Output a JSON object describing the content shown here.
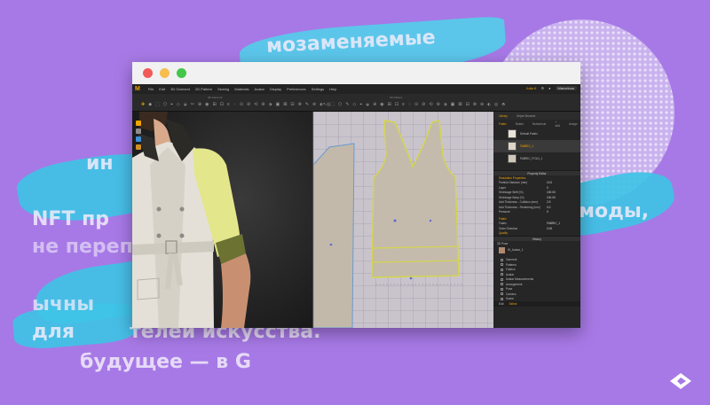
{
  "background": {
    "lines": [
      "мозаменяемые",
      "ин",
      "NFT пр",
      "моды,",
      "не переп",
      "ычны",
      "для",
      "телей искусства.",
      "будущее — в G"
    ],
    "accent": "#3fc3e6",
    "purple": "#a779e6"
  },
  "window": {
    "menu": {
      "logo": "M",
      "items": [
        "File",
        "Edit",
        "3D Garment",
        "2D Pattern",
        "Sewing",
        "Materials",
        "Avatar",
        "Display",
        "Preferences",
        "Settings",
        "Help"
      ],
      "user": "Julia K",
      "badge": "Marvelous"
    },
    "toolbar": {
      "label_3d": "3D Garment",
      "label_2d": "2D Pattern",
      "tools_3d": [
        "✥",
        "◆",
        "⬚",
        "⬡",
        "⌖",
        "◇",
        "⬙",
        "✂",
        "⊕",
        "◉",
        "⊞",
        "⊡",
        "≡",
        "◌",
        "⊙",
        "⊘",
        "⟲",
        "⊛",
        "⬗",
        "▣",
        "⊠",
        "⊟",
        "⊗",
        "✎",
        "⊚",
        "⬖",
        "◎"
      ],
      "tools_2d": [
        "↖",
        "⬚",
        "⬡",
        "✎",
        "◇",
        "⌖",
        "⬙",
        "⊕",
        "◉",
        "⊞",
        "⊡",
        "≡",
        "◌",
        "⊙",
        "⊘",
        "⟲",
        "⊛",
        "⬗",
        "▣",
        "⊠",
        "⊟",
        "⊗",
        "⊚",
        "⬖",
        "◎",
        "⬘"
      ]
    },
    "panel": {
      "library_tabs": [
        "Library",
        "Object Browser"
      ],
      "fabric_tabs": [
        "Fabric",
        "Button",
        "Buttonhole"
      ],
      "fabric_actions": [
        "+ Add",
        "Assign"
      ],
      "fabrics": [
        "Default Fabric",
        "FABRIC_1",
        "FABRIC_FOLD_1"
      ],
      "simulation_header": "Property Editor",
      "simulation_title": "Simulation Properties",
      "simulation_rows": [
        {
          "label": "Particle Distance (mm)",
          "value": "10.0",
          "unit": ""
        },
        {
          "label": "Layer",
          "value": "0",
          "unit": ""
        },
        {
          "label": "Shrinkage Weft (%)",
          "value": "100.00",
          "unit": ""
        },
        {
          "label": "Shrinkage Warp (%)",
          "value": "100.00",
          "unit": ""
        },
        {
          "label": "Add Thickness - Collision (mm)",
          "value": "2.5",
          "unit": ""
        },
        {
          "label": "Add Thickness - Rendering (mm)",
          "value": "0.0",
          "unit": ""
        },
        {
          "label": "Pressure",
          "value": "0",
          "unit": ""
        }
      ],
      "fabric_section": "Fabric",
      "fabric_rows": [
        {
          "label": "Fabric",
          "value": "FABRIC_1"
        },
        {
          "label": "Grain Direction",
          "value": "0.00"
        }
      ],
      "quality_label": "Quality",
      "history_header": "History",
      "object_header": "3D Pose",
      "avatar_name": "W_Avatar_1",
      "tree_rows": [
        "Garment",
        "Patterns",
        "Fabrics",
        "Avatar",
        "Avatar Measurements",
        "Arrangement",
        "Pose",
        "Camera",
        "Scene"
      ],
      "bottom": [
        "Edit",
        "Select"
      ]
    }
  }
}
